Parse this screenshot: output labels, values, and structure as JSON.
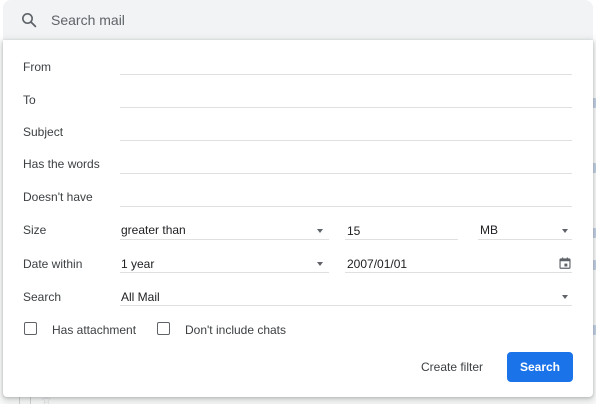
{
  "search_bar": {
    "placeholder": "Search mail",
    "icon": "search-icon"
  },
  "filter": {
    "from_label": "From",
    "from_value": "",
    "to_label": "To",
    "to_value": "",
    "subject_label": "Subject",
    "subject_value": "",
    "has_words_label": "Has the words",
    "has_words_value": "",
    "doesnt_have_label": "Doesn't have",
    "doesnt_have_value": "",
    "size_label": "Size",
    "size_operator": "greater than",
    "size_value": "15",
    "size_unit": "MB",
    "date_within_label": "Date within",
    "date_range": "1 year",
    "date_value": "2007/01/01",
    "search_label": "Search",
    "search_scope": "All Mail",
    "has_attachment_label": "Has attachment",
    "has_attachment_checked": false,
    "dont_include_chats_label": "Don't include chats",
    "dont_include_chats_checked": false,
    "create_filter_label": "Create filter",
    "search_button_label": "Search"
  },
  "colors": {
    "primary": "#1a73e8",
    "search_bar_bg": "#f1f3f4",
    "divider": "#e0e0e0",
    "text": "#202124",
    "label": "#3c4043"
  }
}
